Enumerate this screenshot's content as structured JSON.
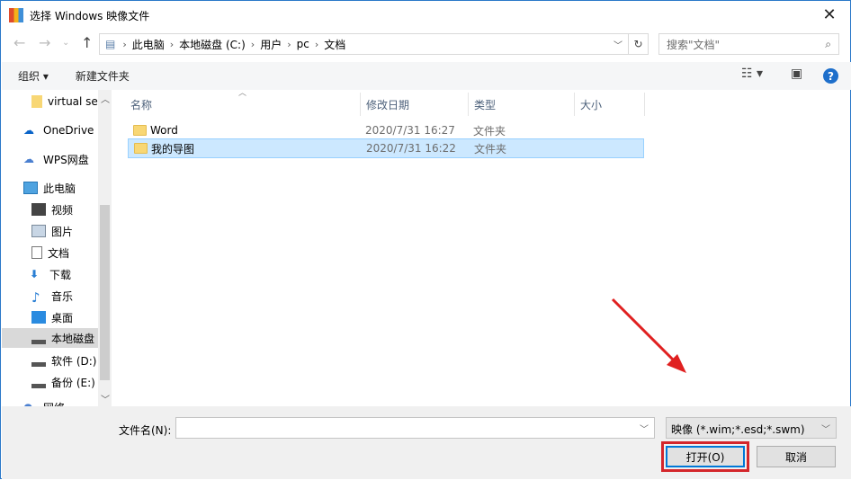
{
  "window": {
    "title": "选择 Windows 映像文件",
    "close_label": "✕"
  },
  "nav": {
    "breadcrumb": [
      "此电脑",
      "本地磁盘 (C:)",
      "用户",
      "pc",
      "文档"
    ],
    "search_placeholder": "搜索\"文档\""
  },
  "toolbar": {
    "organize": "组织 ▾",
    "new_folder": "新建文件夹"
  },
  "sidebar": {
    "items": [
      {
        "label": "virtual se",
        "icon": "folder-icon"
      },
      {
        "label": "OneDrive",
        "icon": "cloud-icon"
      },
      {
        "label": "WPS网盘",
        "icon": "cloud-outline-icon"
      },
      {
        "label": "此电脑",
        "icon": "computer-icon"
      },
      {
        "label": "视频",
        "icon": "video-icon"
      },
      {
        "label": "图片",
        "icon": "picture-icon"
      },
      {
        "label": "文档",
        "icon": "document-icon"
      },
      {
        "label": "下载",
        "icon": "download-icon"
      },
      {
        "label": "音乐",
        "icon": "music-icon"
      },
      {
        "label": "桌面",
        "icon": "desktop-icon"
      },
      {
        "label": "本地磁盘",
        "icon": "drive-icon"
      },
      {
        "label": "软件 (D:)",
        "icon": "drive-icon"
      },
      {
        "label": "备份 (E:)",
        "icon": "drive-icon"
      },
      {
        "label": "网络",
        "icon": "network-icon"
      }
    ]
  },
  "list": {
    "columns": [
      "名称",
      "修改日期",
      "类型",
      "大小"
    ],
    "rows": [
      {
        "name": "Word",
        "date": "2020/7/31 16:27",
        "type": "文件夹"
      },
      {
        "name": "我的导图",
        "date": "2020/7/31 16:22",
        "type": "文件夹"
      }
    ]
  },
  "bottom": {
    "filename_label": "文件名(N):",
    "filename_value": "",
    "filter": "映像 (*.wim;*.esd;*.swm)",
    "open": "打开(O)",
    "cancel": "取消"
  },
  "colors": {
    "accent": "#0078d7",
    "highlight": "#d4262b",
    "selection": "#cce8ff"
  }
}
